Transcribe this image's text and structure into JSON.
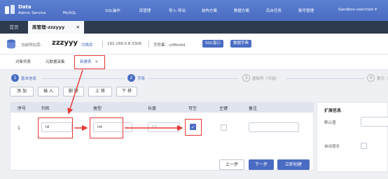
{
  "app": {
    "brand_name": "Data",
    "brand_sub": "Admin Service",
    "brand_db": "MySQL",
    "menu": [
      "SQL操作",
      "库管理",
      "导入-导出",
      "结构方案",
      "数据方案",
      "后台任务",
      "账号管理"
    ],
    "user": "Sandbox-user/root ▾"
  },
  "tabs": {
    "home": "首页",
    "active": "库管理-zzzyyy",
    "close": "✕"
  },
  "info": {
    "current_db_label": "当前所在库:",
    "db_name": "zzzyyy",
    "switch_db": "切换库",
    "host": "192.168.0.8:3306",
    "charset": "字符集：utf8mb4",
    "sql_window": "SQL窗口",
    "data_dict": "数据字典"
  },
  "subtabs": [
    "对象列表",
    "元数据采集",
    "新建表"
  ],
  "subtab_close": "✕",
  "steps": [
    {
      "num": "1",
      "label": "基本信息"
    },
    {
      "num": "2",
      "label": "字段"
    },
    {
      "num": "3",
      "label": "虚拟列（可选）"
    },
    {
      "num": "4",
      "label": "索引（可"
    }
  ],
  "toolbar": [
    "添 加",
    "插 入",
    "删 除",
    "上 移",
    "下 移"
  ],
  "columns": {
    "headers": [
      "序号",
      "列名",
      "类型",
      "长度",
      "可空",
      "主键",
      "备注"
    ],
    "row": {
      "no": "1",
      "name": "id",
      "type": "int",
      "length": "11",
      "nullable": true,
      "primary": false
    }
  },
  "side": {
    "title": "扩展信息",
    "default_label": "默认值",
    "auto_inc_label": "自动增长"
  },
  "footer": {
    "prev": "上一步",
    "next": "下一步",
    "create": "立即创建"
  },
  "colors": {
    "accent": "#4a6cc2",
    "highlight": "#e53935",
    "tabbar": "#2e3a4e"
  }
}
